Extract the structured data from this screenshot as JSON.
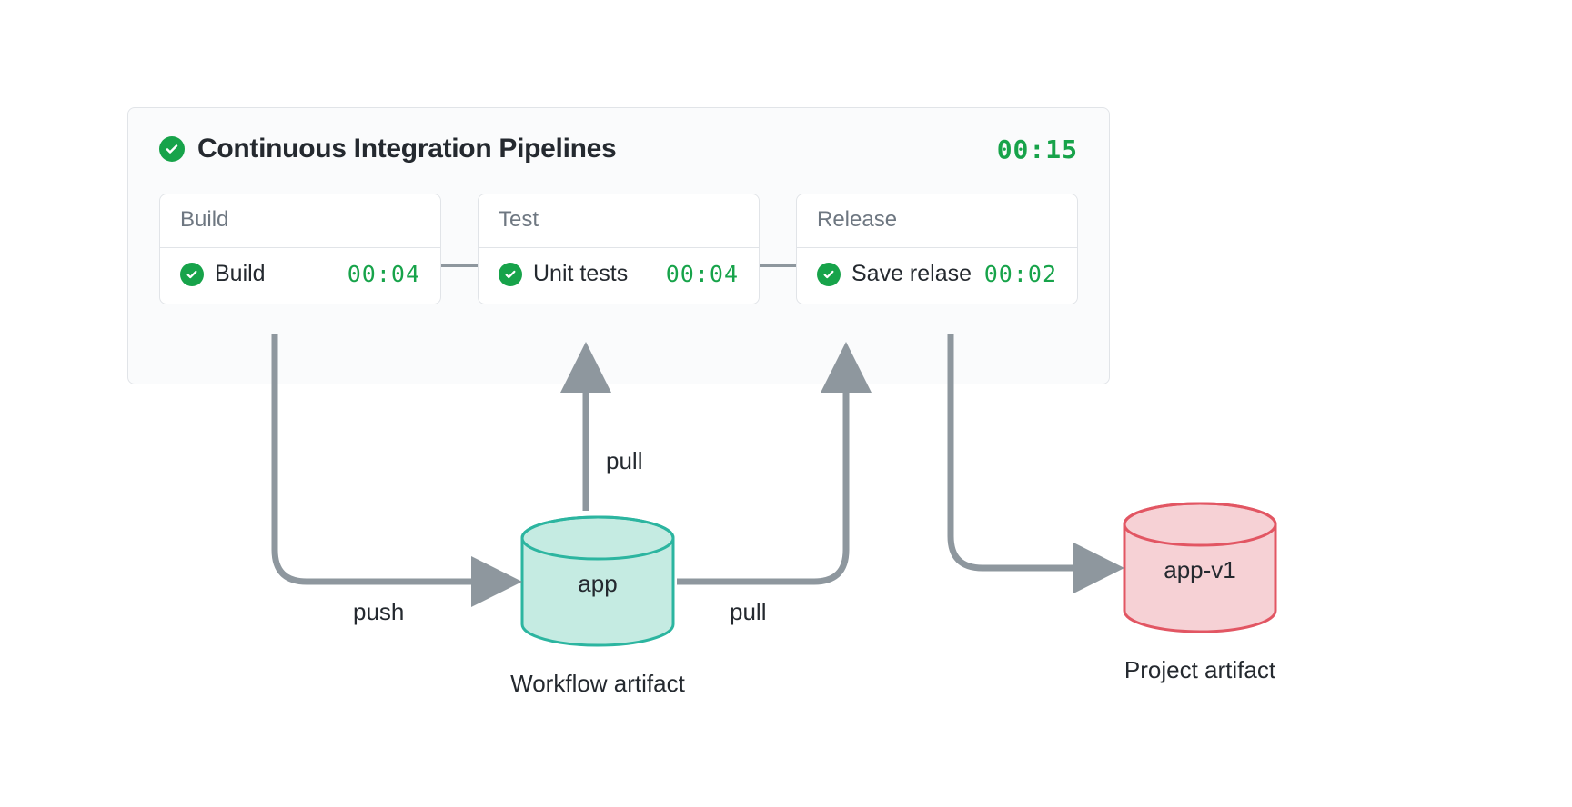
{
  "pipeline": {
    "title": "Continuous Integration Pipelines",
    "total_time": "00:15",
    "stages": [
      {
        "name": "Build",
        "job": "Build",
        "time": "00:04"
      },
      {
        "name": "Test",
        "job": "Unit tests",
        "time": "00:04"
      },
      {
        "name": "Release",
        "job": "Save relase",
        "time": "00:02"
      }
    ]
  },
  "flows": {
    "push": "push",
    "pull1": "pull",
    "pull2": "pull"
  },
  "artifacts": {
    "workflow": {
      "label": "app",
      "caption": "Workflow artifact"
    },
    "project": {
      "label": "app-v1",
      "caption": "Project artifact"
    }
  },
  "colors": {
    "green": "#17a34a",
    "teal": "#2cb5a0",
    "red": "#e25663",
    "arrow": "#8e979e"
  }
}
